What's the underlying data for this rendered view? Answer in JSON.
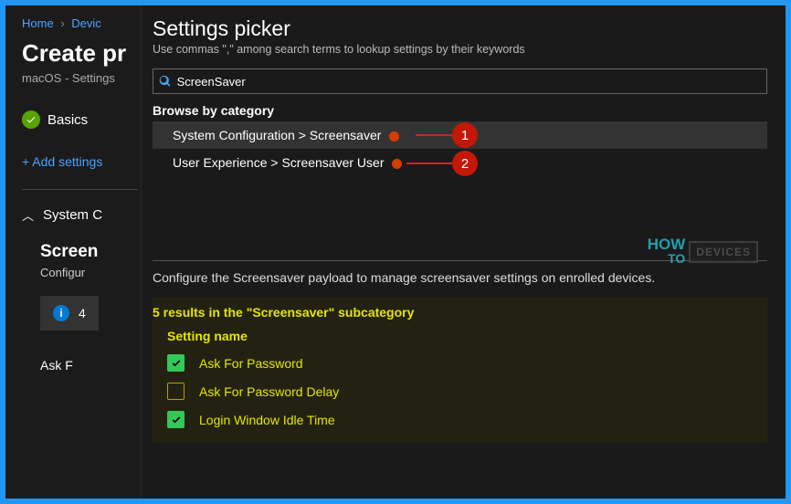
{
  "breadcrumb": {
    "home": "Home",
    "devices": "Devic"
  },
  "page": {
    "title": "Create pr",
    "subtitle": "macOS - Settings"
  },
  "step": {
    "basics": "Basics"
  },
  "add_settings": "+ Add settings",
  "expand": {
    "label": "System C"
  },
  "section": {
    "title": "Screen",
    "desc": "Configur"
  },
  "info": {
    "count": "4"
  },
  "ask_partial": "Ask F",
  "panel": {
    "title": "Settings picker",
    "hint": "Use commas \",\" among search terms to lookup settings by their keywords",
    "search_value": "ScreenSaver",
    "browse_label": "Browse by category",
    "categories": [
      "System Configuration > Screensaver",
      "User Experience > Screensaver User"
    ],
    "configure_text": "Configure the Screensaver payload to manage screensaver settings on enrolled devices.",
    "results_header": "5 results in the \"Screensaver\" subcategory",
    "setting_name": "Setting name",
    "settings": [
      {
        "label": "Ask For Password",
        "checked": true
      },
      {
        "label": "Ask For Password Delay",
        "checked": false
      },
      {
        "label": "Login Window Idle Time",
        "checked": true
      }
    ]
  },
  "annotations": {
    "one": "1",
    "two": "2"
  },
  "logo": {
    "how": "HOW",
    "to": "TO",
    "devices": "DEVICES"
  }
}
